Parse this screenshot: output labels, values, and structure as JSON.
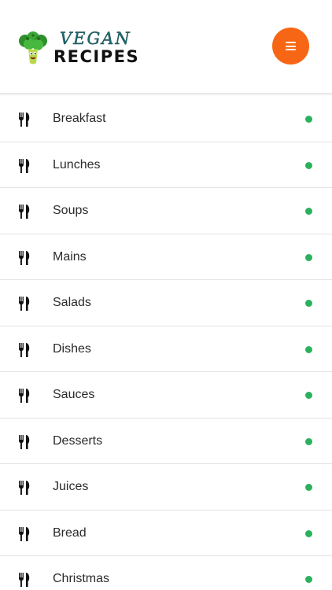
{
  "header": {
    "logo_top": "VEGAN",
    "logo_bottom": "RECIPES",
    "menu_icon": "hamburger-icon",
    "accent_color": "#f76614"
  },
  "categories": [
    {
      "label": "Breakfast"
    },
    {
      "label": "Lunches"
    },
    {
      "label": "Soups"
    },
    {
      "label": "Mains"
    },
    {
      "label": "Salads"
    },
    {
      "label": "Dishes"
    },
    {
      "label": "Sauces"
    },
    {
      "label": "Desserts"
    },
    {
      "label": "Juices"
    },
    {
      "label": "Bread"
    },
    {
      "label": "Christmas"
    }
  ],
  "item_icon": "fork-knife-icon",
  "status_dot_color": "#2bb15e"
}
